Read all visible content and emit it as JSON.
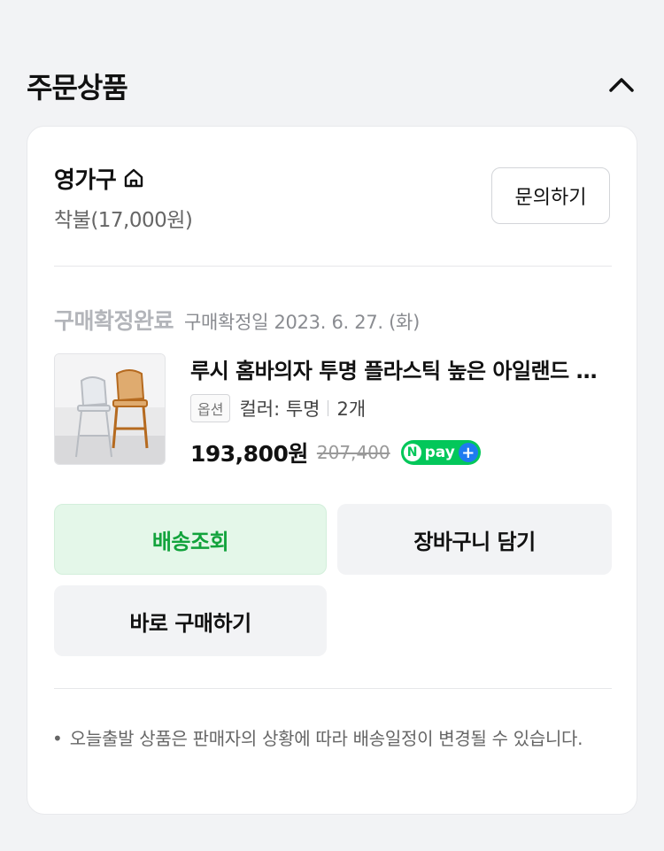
{
  "header": {
    "title": "주문상품",
    "collapse_icon": "chevron-up-icon"
  },
  "seller": {
    "name": "영가구",
    "home_icon": "home-icon",
    "shipping_fee": "착불(17,000원)",
    "inquiry_label": "문의하기"
  },
  "order": {
    "status": "구매확정완료",
    "confirm_date": "구매확정일 2023. 6. 27. (화)"
  },
  "product": {
    "name": "루시 홈바의자 투명 플라스틱 높은 아일랜드 식탁의자",
    "option_badge": "옵션",
    "option_value": "컬러: 투명",
    "quantity": "2개",
    "price": "193,800원",
    "original_price": "207,400",
    "npay_n": "N",
    "npay_label": "pay",
    "npay_plus": "+"
  },
  "actions": {
    "track_label": "배송조회",
    "cart_label": "장바구니 담기",
    "buy_again_label": "바로 구매하기"
  },
  "notice": {
    "bullet": "•",
    "text": "오늘출발 상품은 판매자의 상황에 따라 배송일정이 변경될 수 있습니다."
  },
  "colors": {
    "background": "#f2f3f5",
    "status_label": "#b3b5ba",
    "track_button_bg": "#e4f7e9",
    "track_button_text": "#12a33c",
    "npay_green": "#03c75a",
    "npay_plus_blue": "#1e7bf0"
  }
}
